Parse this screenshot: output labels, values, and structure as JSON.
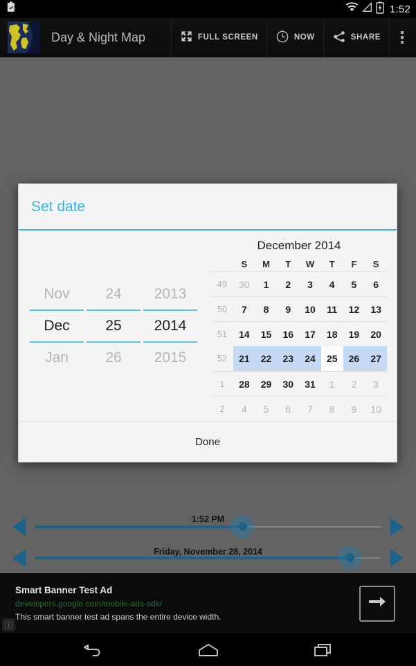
{
  "status_bar": {
    "time": "1:52",
    "icons": [
      "clipboard-check-icon",
      "wifi-icon",
      "signal-icon",
      "battery-charging-icon"
    ]
  },
  "action_bar": {
    "app_icon": "world-map-icon",
    "title": "Day & Night Map",
    "actions": [
      {
        "id": "fullscreen",
        "icon": "expand-icon",
        "label": "FULL SCREEN"
      },
      {
        "id": "now",
        "icon": "clock-icon",
        "label": "NOW"
      },
      {
        "id": "share",
        "icon": "share-icon",
        "label": "SHARE"
      }
    ],
    "overflow_icon": "overflow-menu-icon"
  },
  "dialog": {
    "title": "Set date",
    "accent_color": "#33b5e5",
    "done_label": "Done",
    "spinners": [
      {
        "name": "month",
        "prev": "Nov",
        "current": "Dec",
        "next": "Jan"
      },
      {
        "name": "day",
        "prev": "24",
        "current": "25",
        "next": "26"
      },
      {
        "name": "year",
        "prev": "2013",
        "current": "2014",
        "next": "2015"
      }
    ],
    "calendar": {
      "month_title": "December 2014",
      "day_headers": [
        "S",
        "M",
        "T",
        "W",
        "T",
        "F",
        "S"
      ],
      "highlight_color": "#c5d9f4",
      "selected_day": 25,
      "weeks": [
        {
          "week": "49",
          "days": [
            {
              "n": "30",
              "other": true
            },
            {
              "n": "1"
            },
            {
              "n": "2"
            },
            {
              "n": "3"
            },
            {
              "n": "4"
            },
            {
              "n": "5"
            },
            {
              "n": "6"
            }
          ]
        },
        {
          "week": "50",
          "days": [
            {
              "n": "7"
            },
            {
              "n": "8"
            },
            {
              "n": "9"
            },
            {
              "n": "10"
            },
            {
              "n": "11"
            },
            {
              "n": "12"
            },
            {
              "n": "13"
            }
          ]
        },
        {
          "week": "51",
          "days": [
            {
              "n": "14"
            },
            {
              "n": "15"
            },
            {
              "n": "16"
            },
            {
              "n": "17"
            },
            {
              "n": "18"
            },
            {
              "n": "19"
            },
            {
              "n": "20"
            }
          ]
        },
        {
          "week": "52",
          "selected": true,
          "days": [
            {
              "n": "21",
              "hl": true
            },
            {
              "n": "22",
              "hl": true
            },
            {
              "n": "23",
              "hl": true
            },
            {
              "n": "24",
              "hl": true
            },
            {
              "n": "25",
              "today": true
            },
            {
              "n": "26",
              "hl": true
            },
            {
              "n": "27",
              "hl": true
            }
          ]
        },
        {
          "week": "1",
          "days": [
            {
              "n": "28"
            },
            {
              "n": "29"
            },
            {
              "n": "30"
            },
            {
              "n": "31"
            },
            {
              "n": "1",
              "other": true
            },
            {
              "n": "2",
              "other": true
            },
            {
              "n": "3",
              "other": true
            }
          ]
        },
        {
          "week": "2",
          "days": [
            {
              "n": "4",
              "other": true
            },
            {
              "n": "5",
              "other": true
            },
            {
              "n": "6",
              "other": true
            },
            {
              "n": "7",
              "other": true
            },
            {
              "n": "8",
              "other": true
            },
            {
              "n": "9",
              "other": true
            },
            {
              "n": "10",
              "other": true
            }
          ]
        }
      ]
    }
  },
  "sliders": {
    "time_slider": {
      "label": "1:52 PM",
      "fill_percent": 60,
      "thumb_percent": 60,
      "prev_icon": "arrow-left-icon",
      "next_icon": "arrow-right-icon"
    },
    "date_slider": {
      "label": "Friday, November 28, 2014",
      "fill_percent": 91,
      "thumb_percent": 91,
      "prev_icon": "arrow-left-icon",
      "next_icon": "arrow-right-icon"
    },
    "accent_color": "#1d6288"
  },
  "ad": {
    "title": "Smart Banner Test Ad",
    "url": "developers.google.com/mobile-ads-sdk/",
    "body": "This smart banner test ad spans the entire device width.",
    "cta_icon": "arrow-right-icon",
    "info_icon": "info-icon",
    "info_label": "ⓘ"
  },
  "nav_bar": {
    "buttons": [
      {
        "id": "back",
        "icon": "back-arrow-icon"
      },
      {
        "id": "home",
        "icon": "home-icon"
      },
      {
        "id": "recents",
        "icon": "recents-icon"
      }
    ]
  }
}
